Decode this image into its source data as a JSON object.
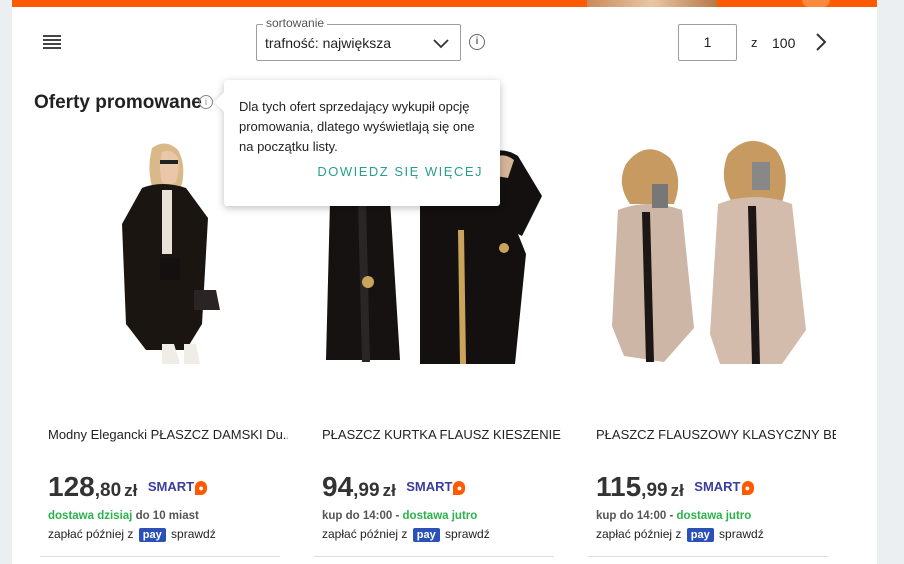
{
  "toolbar": {
    "sort_legend": "sortowanie",
    "sort_value": "trafność: największa",
    "page_current": "1",
    "page_of": "z",
    "page_total": "100"
  },
  "section": {
    "title": "Oferty promowane",
    "info_icon": "i"
  },
  "tooltip": {
    "text": "Dla tych ofert sprzedający wykupił opcję promowania, dlatego wyświetlają się one na początku listy.",
    "link": "DOWIEDZ SIĘ WIĘCEJ"
  },
  "offers": [
    {
      "title": "Modny Elegancki PŁASZCZ DAMSKI Du...",
      "price_int": "128",
      "price_dec": ",80",
      "currency": "zł",
      "smart": "SMART",
      "delivery_prefix": "",
      "delivery_green": "dostawa dzisiaj",
      "delivery_suffix": "do 10 miast",
      "paylater_prefix": "zapłać później z",
      "pay_badge": "pay",
      "paylater_suffix": "sprawdź"
    },
    {
      "title": "PŁASZCZ KURTKA FLAUSZ KIESZENIE Z...",
      "price_int": "94",
      "price_dec": ",99",
      "currency": "zł",
      "smart": "SMART",
      "delivery_prefix": "kup do 14:00 -",
      "delivery_green": "dostawa jutro",
      "delivery_suffix": "",
      "paylater_prefix": "zapłać później z",
      "pay_badge": "pay",
      "paylater_suffix": "sprawdź"
    },
    {
      "title": "PŁASZCZ FLAUSZOWY KLASYCZNY BEŻ...",
      "price_int": "115",
      "price_dec": ",99",
      "currency": "zł",
      "smart": "SMART",
      "delivery_prefix": "kup do 14:00 -",
      "delivery_green": "dostawa jutro",
      "delivery_suffix": "",
      "paylater_prefix": "zapłać później z",
      "pay_badge": "pay",
      "paylater_suffix": "sprawdź"
    }
  ],
  "colors": {
    "brand": "#ff5a00",
    "link": "#2a9d8f",
    "delivery_green": "#2bb24c",
    "smart": "#3b3d9c",
    "pay": "#2b50b8"
  },
  "icons": [
    "list-view-icon",
    "chevron-down-icon",
    "info-icon",
    "chevron-right-icon"
  ]
}
